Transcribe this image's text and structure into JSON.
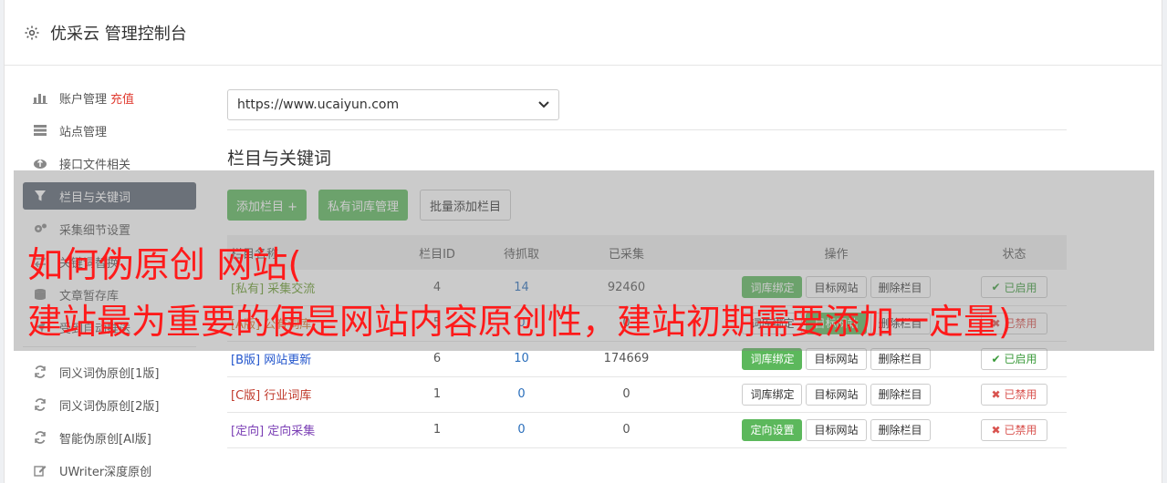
{
  "header": {
    "title": "优采云 管理控制台"
  },
  "sidebar": {
    "items": [
      {
        "label": "账户管理",
        "extra": "充值",
        "icon": "bar-chart-icon"
      },
      {
        "label": "站点管理",
        "icon": "server-icon"
      },
      {
        "label": "接口文件相关",
        "icon": "cloud-upload-icon"
      },
      {
        "label": "栏目与关键词",
        "icon": "filter-icon",
        "active": true
      },
      {
        "label": "采集细节设置",
        "icon": "cogs-icon"
      },
      {
        "label": "关键词替换",
        "icon": "exchange-icon"
      },
      {
        "label": "文章暂存库",
        "icon": "database-icon"
      },
      {
        "label": "受到自动推送",
        "icon": "send-icon"
      }
    ],
    "tools": [
      {
        "label": "同义词伪原创[1版]",
        "icon": "refresh-icon"
      },
      {
        "label": "同义词伪原创[2版]",
        "icon": "refresh-icon"
      },
      {
        "label": "智能伪原创[AI版]",
        "icon": "refresh-icon"
      },
      {
        "label": "UWriter深度原创",
        "icon": "edit-icon"
      }
    ]
  },
  "site_select": {
    "value": "https://www.ucaiyun.com"
  },
  "section": {
    "title": "栏目与关键词"
  },
  "buttons": {
    "add_column": "添加栏目 +",
    "private_lib": "私有词库管理",
    "batch_add": "批量添加栏目"
  },
  "table": {
    "headers": [
      "栏目名称",
      "栏目ID",
      "待抓取",
      "已采集",
      "操作",
      "状态"
    ],
    "rows": [
      {
        "tag": "[私有]",
        "name": "采集交流",
        "id": "4",
        "pending": "14",
        "collected": "92460",
        "first_btn": "词库绑定",
        "first_green": true,
        "second_btn": "目标网站",
        "third_btn": "删除栏目",
        "status": "已启用",
        "enabled": true
      },
      {
        "tag": "[A版]",
        "name": "公有词库",
        "id": "5",
        "pending": "0",
        "collected": "0",
        "first_btn": "词库绑定",
        "first_green": false,
        "second_btn": "目标网站",
        "third_btn": "删除栏目",
        "status": "已禁用",
        "enabled": false
      },
      {
        "tag": "[B版]",
        "name": "网站更新",
        "id": "6",
        "pending": "10",
        "collected": "174669",
        "first_btn": "词库绑定",
        "first_green": true,
        "second_btn": "目标网站",
        "third_btn": "删除栏目",
        "status": "已启用",
        "enabled": true
      },
      {
        "tag": "[C版]",
        "name": "行业词库",
        "id": "1",
        "pending": "0",
        "collected": "0",
        "first_btn": "词库绑定",
        "first_green": false,
        "second_btn": "目标网站",
        "third_btn": "删除栏目",
        "status": "已禁用",
        "enabled": false
      },
      {
        "tag": "[定向]",
        "name": "定向采集",
        "id": "1",
        "pending": "0",
        "collected": "0",
        "first_btn": "定向设置",
        "first_green": true,
        "second_btn": "目标网站",
        "third_btn": "删除栏目",
        "status": "已禁用",
        "enabled": false
      }
    ]
  },
  "overlay": {
    "line1": "如何伪原创 网站(",
    "line2": "建站最为重要的便是网站内容原创性，建站初期需要添加一定量)"
  }
}
